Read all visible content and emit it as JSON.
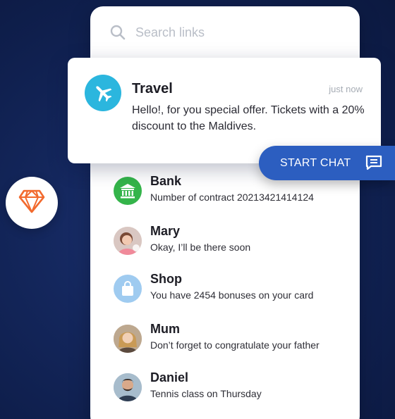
{
  "search": {
    "placeholder": "Search links"
  },
  "notification": {
    "title": "Travel",
    "time": "just now",
    "message": "Hello!, for you special offer. Tickets with a 20% discount to the Maldives.",
    "icon": "airplane-icon",
    "accent": "#2bb6de"
  },
  "start_chat": {
    "label": "START CHAT",
    "icon": "chat-icon",
    "color": "#2c5ec0"
  },
  "contacts": [
    {
      "name": "Bank",
      "message": "Number of contract 20213421414124",
      "icon": "bank-icon",
      "color": "#34b44a"
    },
    {
      "name": "Mary",
      "message": "Okay, I’ll be there soon",
      "icon": "avatar-photo"
    },
    {
      "name": "Shop",
      "message": "You have 2454 bonuses on your card",
      "icon": "shopping-bag-icon",
      "color": "#9fcbf0"
    },
    {
      "name": "Mum",
      "message": "Don’t forget to congratulate your father",
      "icon": "avatar-photo"
    },
    {
      "name": "Daniel",
      "message": "Tennis class on Thursday",
      "icon": "avatar-photo"
    }
  ],
  "badge": {
    "icon": "diamond-icon",
    "color": "#f26a2e"
  }
}
